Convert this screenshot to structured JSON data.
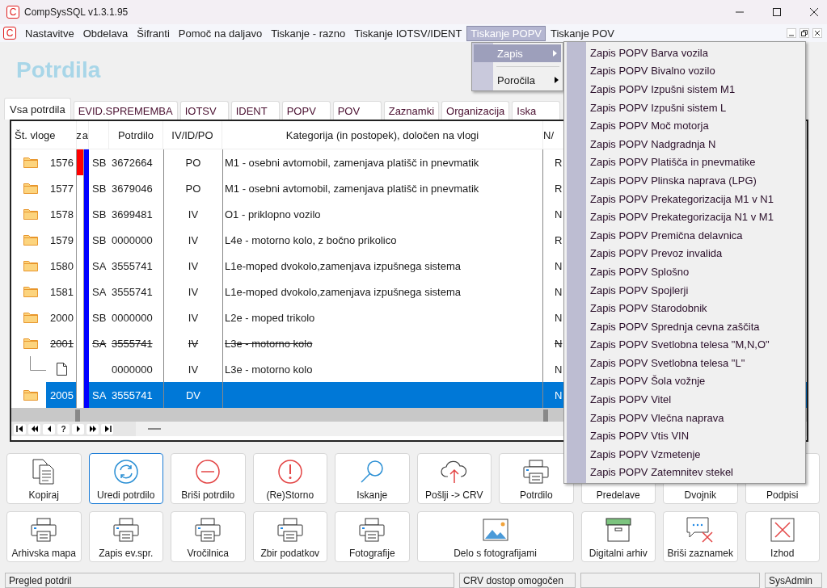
{
  "window": {
    "title": "CompSysSQL v1.3.1.95",
    "logo_letter": "C"
  },
  "menu": {
    "logo_letter": "C",
    "items": [
      {
        "label": "Nastavitve",
        "selected": false
      },
      {
        "label": "Obdelava",
        "selected": false
      },
      {
        "label": "Šifranti",
        "selected": false
      },
      {
        "label": "Pomoč na daljavo",
        "selected": false
      },
      {
        "label": "Tiskanje - razno",
        "selected": false
      },
      {
        "label": "Tiskanje IOTSV/IDENT",
        "selected": false
      },
      {
        "label": "Tiskanje POPV",
        "selected": true
      },
      {
        "label": "Tiskanje POV",
        "selected": false
      }
    ]
  },
  "page_title": "Potrdila",
  "tabs": [
    {
      "label": "Vsa potrdila",
      "selected": true
    },
    {
      "label": "EVID.SPREMEMBA",
      "selected": false
    },
    {
      "label": "IOTSV",
      "selected": false
    },
    {
      "label": "IDENT",
      "selected": false
    },
    {
      "label": "POPV",
      "selected": false
    },
    {
      "label": "POV",
      "selected": false
    },
    {
      "label": "Zaznamki",
      "selected": false
    },
    {
      "label": "Organizacija",
      "selected": false
    },
    {
      "label": "Iska",
      "selected": false
    }
  ],
  "table": {
    "columns": [
      "Št. vloge",
      "za",
      "Potrdilo",
      "IV/ID/PO",
      "Kategorija (in postopek), določen na vlogi",
      "N/"
    ],
    "rows": [
      {
        "kind": "folder",
        "vloga": "1576",
        "serija": "SB",
        "potrdilo": "3672664",
        "tip": "PO",
        "kategorija": "M1 - osebni avtomobil, zamenjava platišč in pnevmatik",
        "ni": "R",
        "color": "#ff0000",
        "selected": false,
        "cancelled": false
      },
      {
        "kind": "folder",
        "vloga": "1577",
        "serija": "SB",
        "potrdilo": "3679046",
        "tip": "PO",
        "kategorija": "M1 - osebni avtomobil, zamenjava platišč in pnevmatik",
        "ni": "R",
        "selected": false,
        "cancelled": false
      },
      {
        "kind": "folder",
        "vloga": "1578",
        "serija": "SB",
        "potrdilo": "3699481",
        "tip": "IV",
        "kategorija": "O1 - priklopno vozilo",
        "ni": "N",
        "selected": false,
        "cancelled": false
      },
      {
        "kind": "folder",
        "vloga": "1579",
        "serija": "SB",
        "potrdilo": "0000000",
        "tip": "IV",
        "kategorija": "L4e - motorno kolo, z bočno prikolico",
        "ni": "R",
        "selected": false,
        "cancelled": false
      },
      {
        "kind": "folder",
        "vloga": "1580",
        "serija": "SA",
        "potrdilo": "3555741",
        "tip": "IV",
        "kategorija": "L1e-moped dvokolo,zamenjava izpušnega sistema",
        "ni": "N",
        "selected": false,
        "cancelled": false
      },
      {
        "kind": "folder",
        "vloga": "1581",
        "serija": "SA",
        "potrdilo": "3555741",
        "tip": "IV",
        "kategorija": "L1e-moped dvokolo,zamenjava izpušnega sistema",
        "ni": "N",
        "selected": false,
        "cancelled": false
      },
      {
        "kind": "folder",
        "vloga": "2000",
        "serija": "SB",
        "potrdilo": "0000000",
        "tip": "IV",
        "kategorija": "L2e - moped trikolo",
        "ni": "N",
        "selected": false,
        "cancelled": false
      },
      {
        "kind": "folder",
        "vloga": "2001",
        "serija": "SA",
        "potrdilo": "3555741",
        "tip": "IV",
        "kategorija": "L3e - motorno kolo",
        "ni": "N",
        "selected": false,
        "cancelled": true,
        "children": [
          {
            "kind": "document",
            "potrdilo": "0000000",
            "tip": "IV",
            "kategorija": "L3e - motorno kolo",
            "ni": "N",
            "selected": false,
            "cancelled": false
          }
        ]
      },
      {
        "kind": "folder",
        "vloga": "2005",
        "serija": "SA",
        "potrdilo": "3555741",
        "tip": "DV",
        "ni": "N",
        "selected": true,
        "cancelled": false
      }
    ]
  },
  "navigator": [
    {
      "kind": "first"
    },
    {
      "kind": "prev-page"
    },
    {
      "kind": "prev"
    },
    {
      "kind": "help",
      "label": "?"
    },
    {
      "kind": "next"
    },
    {
      "kind": "next-page"
    },
    {
      "kind": "last"
    }
  ],
  "buttons": [
    {
      "label": "Kopiraj",
      "focused": false,
      "wide": false
    },
    {
      "label": "Uredi potrdilo",
      "focused": true,
      "wide": false
    },
    {
      "label": "Briši potrdilo",
      "focused": false,
      "wide": false
    },
    {
      "label": "(Re)Storno",
      "focused": false,
      "wide": false
    },
    {
      "label": "Iskanje",
      "focused": false,
      "wide": false
    },
    {
      "label": "Pošlji -> CRV",
      "focused": false,
      "wide": false
    },
    {
      "label": "Potrdilo",
      "focused": false,
      "wide": false
    },
    {
      "label": "Predelave",
      "focused": false,
      "wide": false
    },
    {
      "label": "Dvojnik",
      "focused": false,
      "wide": false
    },
    {
      "label": "Podpisi",
      "focused": false,
      "wide": false
    },
    {
      "label": "Arhivska mapa",
      "focused": false,
      "wide": false
    },
    {
      "label": "Zapis ev.spr.",
      "focused": false,
      "wide": false
    },
    {
      "label": "Vročilnica",
      "focused": false,
      "wide": false
    },
    {
      "label": "Zbir podatkov",
      "focused": false,
      "wide": false
    },
    {
      "label": "Fotografije",
      "focused": false,
      "wide": false
    },
    {
      "label": "Delo s fotografijami",
      "focused": false,
      "wide": true
    },
    {
      "label": "Digitalni arhiv",
      "focused": false,
      "wide": false
    },
    {
      "label": "Briši zaznamek",
      "focused": false,
      "wide": false
    },
    {
      "label": "Izhod",
      "focused": false,
      "wide": false
    }
  ],
  "dropdown": [
    {
      "label": "Zapis",
      "selected": true,
      "submenu": true
    },
    {
      "label": "Poročila",
      "selected": false,
      "submenu": true
    }
  ],
  "submenu": [
    "Zapis POPV Barva vozila",
    "Zapis POPV Bivalno vozilo",
    "Zapis POPV Izpušni sistem M1",
    "Zapis POPV Izpušni sistem L",
    "Zapis POPV Moč motorja",
    "Zapis POPV Nadgradnja N",
    "Zapis POPV Platišča in pnevmatike",
    "Zapis POPV Plinska naprava (LPG)",
    "Zapis POPV Prekategorizacija M1 v N1",
    "Zapis POPV Prekategorizacija N1 v M1",
    "Zapis POPV Premična delavnica",
    "Zapis POPV Prevoz invalida",
    "Zapis POPV Splošno",
    "Zapis POPV Spojlerji",
    "Zapis POPV Starodobnik",
    "Zapis POPV Sprednja cevna zaščita",
    "Zapis POPV Svetlobna telesa \"M,N,O\"",
    "Zapis POPV Svetlobna telesa \"L\"",
    "Zapis POPV Šola vožnje",
    "Zapis POPV Vitel",
    "Zapis POPV Vlečna naprava",
    "Zapis POPV Vtis VIN",
    "Zapis POPV Vzmetenje",
    "Zapis POPV Zatemnitev stekel"
  ],
  "status_bar": [
    {
      "kind": "text",
      "text": "Pregled potdril"
    },
    {
      "kind": "text",
      "text": "CRV dostop omogočen"
    },
    {
      "kind": "empty"
    },
    {
      "kind": "text",
      "text": "SysAdmin"
    }
  ]
}
